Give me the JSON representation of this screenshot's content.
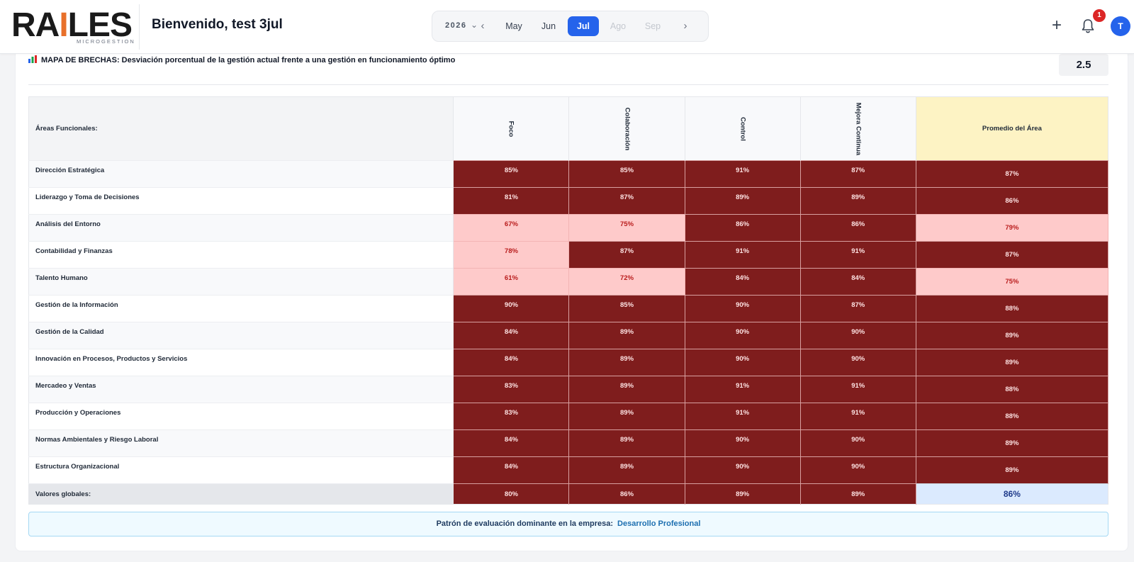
{
  "header": {
    "logo_text_start": "RA",
    "logo_text_accent": "I",
    "logo_text_end": "LES",
    "logo_subtitle": "MICROGESTION",
    "welcome": "Bienvenido, test 3jul",
    "year": "2026",
    "months": [
      {
        "label": "May",
        "state": "normal"
      },
      {
        "label": "Jun",
        "state": "normal"
      },
      {
        "label": "Jul",
        "state": "active"
      },
      {
        "label": "Ago",
        "state": "disabled"
      },
      {
        "label": "Sep",
        "state": "disabled"
      }
    ],
    "notification_count": "1",
    "avatar_initial": "T"
  },
  "section": {
    "title": "MAPA DE BRECHAS: Desviación porcentual de la gestión actual frente a una gestión en funcionamiento óptimo",
    "score": "2.5"
  },
  "table": {
    "area_header": "Áreas Funcionales:",
    "dimensions": [
      "Foco",
      "Colaboración",
      "Control",
      "Mejora Continua"
    ],
    "avg_header": "Promedio del Área",
    "rows": [
      {
        "area": "Dirección Estratégica",
        "values": [
          "85%",
          "85%",
          "91%",
          "87%"
        ],
        "avg": "87%",
        "levels": [
          "dark",
          "dark",
          "dark",
          "dark",
          "dark"
        ]
      },
      {
        "area": "Liderazgo y Toma de Decisiones",
        "values": [
          "81%",
          "87%",
          "89%",
          "89%"
        ],
        "avg": "86%",
        "levels": [
          "dark",
          "dark",
          "dark",
          "dark",
          "dark"
        ]
      },
      {
        "area": "Análisis del Entorno",
        "values": [
          "67%",
          "75%",
          "86%",
          "86%"
        ],
        "avg": "79%",
        "levels": [
          "light",
          "light",
          "dark",
          "dark",
          "light"
        ]
      },
      {
        "area": "Contabilidad y Finanzas",
        "values": [
          "78%",
          "87%",
          "91%",
          "91%"
        ],
        "avg": "87%",
        "levels": [
          "light",
          "dark",
          "dark",
          "dark",
          "dark"
        ]
      },
      {
        "area": "Talento Humano",
        "values": [
          "61%",
          "72%",
          "84%",
          "84%"
        ],
        "avg": "75%",
        "levels": [
          "light",
          "light",
          "dark",
          "dark",
          "light"
        ]
      },
      {
        "area": "Gestión de la Información",
        "values": [
          "90%",
          "85%",
          "90%",
          "87%"
        ],
        "avg": "88%",
        "levels": [
          "dark",
          "dark",
          "dark",
          "dark",
          "dark"
        ]
      },
      {
        "area": "Gestión de la Calidad",
        "values": [
          "84%",
          "89%",
          "90%",
          "90%"
        ],
        "avg": "89%",
        "levels": [
          "dark",
          "dark",
          "dark",
          "dark",
          "dark"
        ]
      },
      {
        "area": "Innovación en Procesos, Productos y Servicios",
        "values": [
          "84%",
          "89%",
          "90%",
          "90%"
        ],
        "avg": "89%",
        "levels": [
          "dark",
          "dark",
          "dark",
          "dark",
          "dark"
        ]
      },
      {
        "area": "Mercadeo y Ventas",
        "values": [
          "83%",
          "89%",
          "91%",
          "91%"
        ],
        "avg": "88%",
        "levels": [
          "dark",
          "dark",
          "dark",
          "dark",
          "dark"
        ]
      },
      {
        "area": "Producción y Operaciones",
        "values": [
          "83%",
          "89%",
          "91%",
          "91%"
        ],
        "avg": "88%",
        "levels": [
          "dark",
          "dark",
          "dark",
          "dark",
          "dark"
        ]
      },
      {
        "area": "Normas Ambientales y Riesgo Laboral",
        "values": [
          "84%",
          "89%",
          "90%",
          "90%"
        ],
        "avg": "89%",
        "levels": [
          "dark",
          "dark",
          "dark",
          "dark",
          "dark"
        ]
      },
      {
        "area": "Estructura Organizacional",
        "values": [
          "84%",
          "89%",
          "90%",
          "90%"
        ],
        "avg": "89%",
        "levels": [
          "dark",
          "dark",
          "dark",
          "dark",
          "dark"
        ]
      }
    ],
    "global": {
      "label": "Valores globales:",
      "values": [
        "80%",
        "86%",
        "89%",
        "89%"
      ],
      "avg": "86%"
    }
  },
  "pattern": {
    "label": "Patrón de evaluación dominante en la empresa:",
    "value": "Desarrollo Profesional"
  },
  "colors": {
    "brand_accent": "#e8702a",
    "primary": "#2563eb",
    "gap_dark": "#7f1d1d",
    "gap_light": "#fecaca",
    "avg_header_bg": "#fdf3c4",
    "global_avg_bg": "#dbeafe"
  },
  "icons": {
    "chart": "bar-chart-icon",
    "notifications": "bell-icon",
    "add": "plus-icon"
  }
}
